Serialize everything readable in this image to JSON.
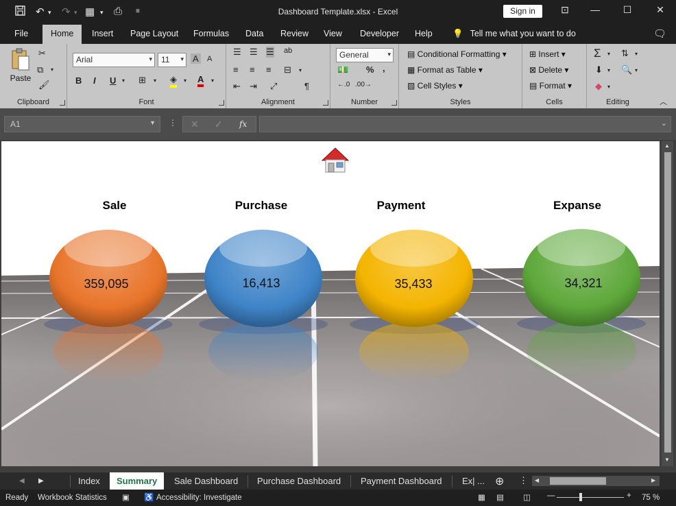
{
  "window": {
    "title": "Dashboard Template.xlsx  -  Excel",
    "sign_in": "Sign in"
  },
  "menu": {
    "tabs": [
      "File",
      "Home",
      "Insert",
      "Page Layout",
      "Formulas",
      "Data",
      "Review",
      "View",
      "Developer",
      "Help"
    ],
    "active": "Home",
    "tell_me": "Tell me what you want to do"
  },
  "ribbon": {
    "clipboard": {
      "label": "Clipboard",
      "paste": "Paste"
    },
    "font": {
      "label": "Font",
      "name": "Arial",
      "size": "11",
      "bold": "B",
      "italic": "I",
      "underline": "U"
    },
    "alignment": {
      "label": "Alignment"
    },
    "number": {
      "label": "Number",
      "format": "General",
      "percent": "%"
    },
    "styles": {
      "label": "Styles",
      "conditional": "Conditional Formatting",
      "format_table": "Format as Table",
      "cell_styles": "Cell Styles"
    },
    "cells": {
      "label": "Cells",
      "insert": "Insert",
      "delete": "Delete",
      "format": "Format"
    },
    "editing": {
      "label": "Editing"
    }
  },
  "formula_bar": {
    "name_box": "A1",
    "fx": "fx",
    "formula": ""
  },
  "dashboard": {
    "metrics": [
      {
        "title": "Sale",
        "value": "359,095",
        "color": "#e8742a"
      },
      {
        "title": "Purchase",
        "value": "16,413",
        "color": "#3f84c8"
      },
      {
        "title": "Payment",
        "value": "35,433",
        "color": "#f4b400"
      },
      {
        "title": "Expanse",
        "value": "34,321",
        "color": "#5ea83b"
      }
    ],
    "home_icon": "house-icon"
  },
  "sheet_tabs": {
    "tabs": [
      "Index",
      "Summary",
      "Sale Dashboard",
      "Purchase Dashboard",
      "Payment Dashboard",
      "Ex| ..."
    ],
    "active": "Summary"
  },
  "status": {
    "ready": "Ready",
    "workbook_stats": "Workbook Statistics",
    "accessibility": "Accessibility: Investigate",
    "zoom": "75 %"
  }
}
